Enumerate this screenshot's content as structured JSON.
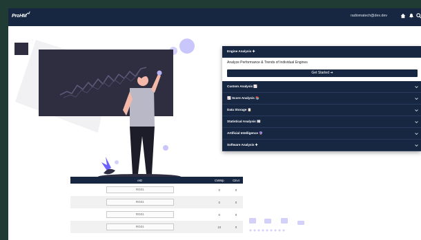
{
  "navbar": {
    "logo": "ProHM",
    "email": "radiomatech@dex.dev"
  },
  "engine_panel": {
    "header": "Engine Analysis ✚",
    "description": "Analyze Performance & Trends of Individual Engines",
    "button": "Get Started ➜"
  },
  "sections": [
    {
      "label": "Custom Analysis 📈"
    },
    {
      "label": "📈 Score Analysis 📚"
    },
    {
      "label": "Data Storage 📋"
    },
    {
      "label": "Statistical Analysis 📰"
    },
    {
      "label": "Artificial Intelligence 🔮"
    },
    {
      "label": "Software Analysis ✚"
    }
  ],
  "table": {
    "headers": [
      "eID",
      "CWMp",
      "CEvt"
    ],
    "rows": [
      {
        "eid": "RG01",
        "cwmp": "0",
        "cevt": "0"
      },
      {
        "eid": "RG01",
        "cwmp": "0",
        "cevt": "0"
      },
      {
        "eid": "RG01",
        "cwmp": "0",
        "cevt": "0"
      },
      {
        "eid": "RG01",
        "cwmp": "10",
        "cevt": "0"
      }
    ]
  },
  "colors": {
    "navy": "#172742",
    "accent": "#b6b3f5",
    "background": "#1f3b33"
  }
}
